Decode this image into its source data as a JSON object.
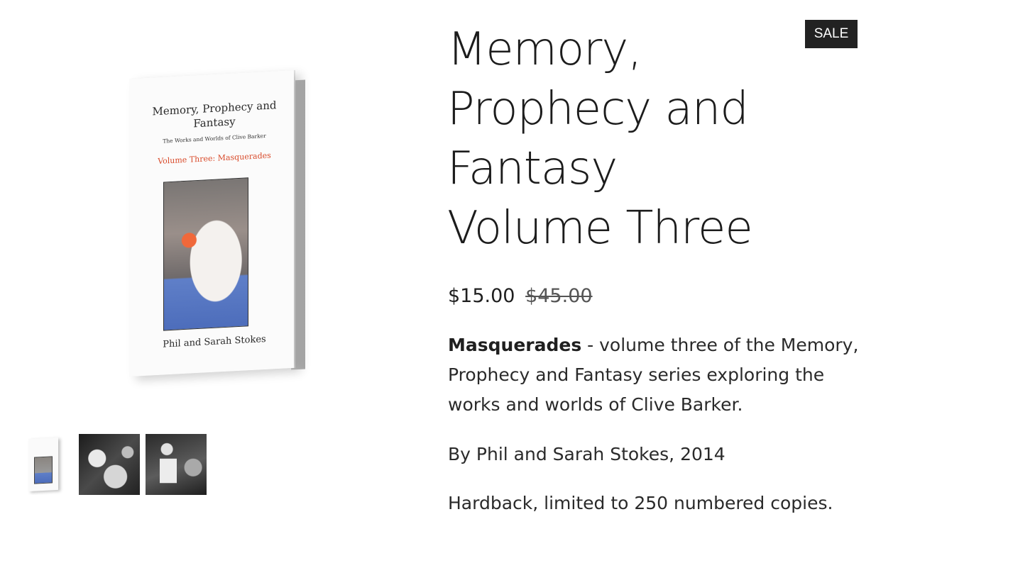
{
  "product": {
    "title": "Memory, Prophecy and Fantasy Volume Three",
    "badge": "SALE",
    "price_sale": "$15.00",
    "price_original": "$45.00",
    "description_bold": "Masquerades",
    "description_rest": " - volume three of the Memory, Prophecy and Fantasy series exploring the works and worlds of Clive Barker.",
    "byline": "By Phil and Sarah Stokes, 2014",
    "edition": "Hardback, limited to 250 numbered copies."
  },
  "cover": {
    "title": "Memory, Prophecy and Fantasy",
    "subtitle": "The Works and Worlds of Clive Barker",
    "volume": "Volume Three: Masquerades",
    "author": "Phil and Sarah Stokes"
  },
  "gallery": {
    "thumbnails": [
      "book-cover-thumbnail",
      "stage-photo-1-thumbnail",
      "stage-photo-2-thumbnail"
    ]
  },
  "colors": {
    "badge_bg": "#222222",
    "badge_text": "#ffffff",
    "cover_accent": "#d94b2b"
  }
}
